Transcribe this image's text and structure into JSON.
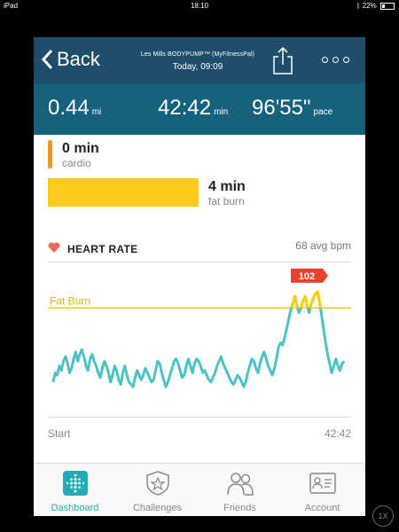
{
  "status_bar": {
    "device": "iPad",
    "time": "18:10",
    "battery": "22%"
  },
  "header": {
    "back_label": "Back",
    "activity_name": "Les Mills BODYPUMP™ (MyFitnessPal)",
    "activity_time": "Today, 09:09"
  },
  "stats": {
    "distance_value": "0.44",
    "distance_unit": "mi",
    "duration_value": "42:42",
    "duration_unit": "min",
    "pace_value": "96'55\"",
    "pace_unit": "pace"
  },
  "zones": [
    {
      "value": "0 min",
      "label": "cardio",
      "color": "#f7931e"
    },
    {
      "value": "4 min",
      "label": "fat burn",
      "color": "#ffc91d"
    }
  ],
  "heart_rate": {
    "label": "HEART RATE",
    "avg": "68 avg bpm",
    "zone_line_label": "Fat Burn",
    "peak_label": "102",
    "start_label": "Start",
    "end_label": "42:42"
  },
  "chart_data": {
    "type": "line",
    "x_start": "Start",
    "x_end": "42:42",
    "fat_burn_threshold": 95,
    "peak": 102,
    "avg": 68,
    "ylim": [
      50,
      110
    ],
    "line_color": "#4cc3c3",
    "threshold_color": "#f5d020",
    "peak_color": "#e8422f",
    "series": [
      {
        "values": [
          63,
          67,
          66,
          70,
          68,
          72,
          74,
          71,
          67,
          69,
          73,
          76,
          72,
          75,
          77,
          74,
          70,
          68,
          73,
          75,
          72,
          70,
          67,
          65,
          69,
          72,
          70,
          67,
          63,
          66,
          70,
          68,
          64,
          62,
          67,
          70,
          66,
          63,
          62,
          61,
          65,
          68,
          66,
          64,
          66,
          69,
          67,
          65,
          63,
          64,
          68,
          72,
          71,
          67,
          64,
          61,
          63,
          66,
          69,
          72,
          73,
          71,
          68,
          65,
          66,
          70,
          73,
          70,
          67,
          71,
          73,
          72,
          70,
          67,
          68,
          66,
          64,
          63,
          65,
          67,
          70,
          72,
          74,
          71,
          69,
          67,
          65,
          63,
          62,
          64,
          66,
          65,
          63,
          61,
          63,
          67,
          70,
          73,
          72,
          69,
          67,
          71,
          74,
          76,
          73,
          70,
          68,
          66,
          69,
          73,
          78,
          80,
          79,
          82,
          86,
          90,
          94,
          97,
          100,
          96,
          93,
          95,
          98,
          100,
          96,
          93,
          97,
          99,
          101,
          102,
          98,
          92,
          86,
          80,
          75,
          71,
          67,
          70,
          73,
          70,
          68,
          71,
          72
        ]
      }
    ]
  },
  "tabs": [
    {
      "label": "Dashboard",
      "icon": "dashboard-icon",
      "active": true
    },
    {
      "label": "Challenges",
      "icon": "challenges-icon",
      "active": false
    },
    {
      "label": "Friends",
      "icon": "friends-icon",
      "active": false
    },
    {
      "label": "Account",
      "icon": "account-icon",
      "active": false
    }
  ],
  "zoom_button": "1X"
}
